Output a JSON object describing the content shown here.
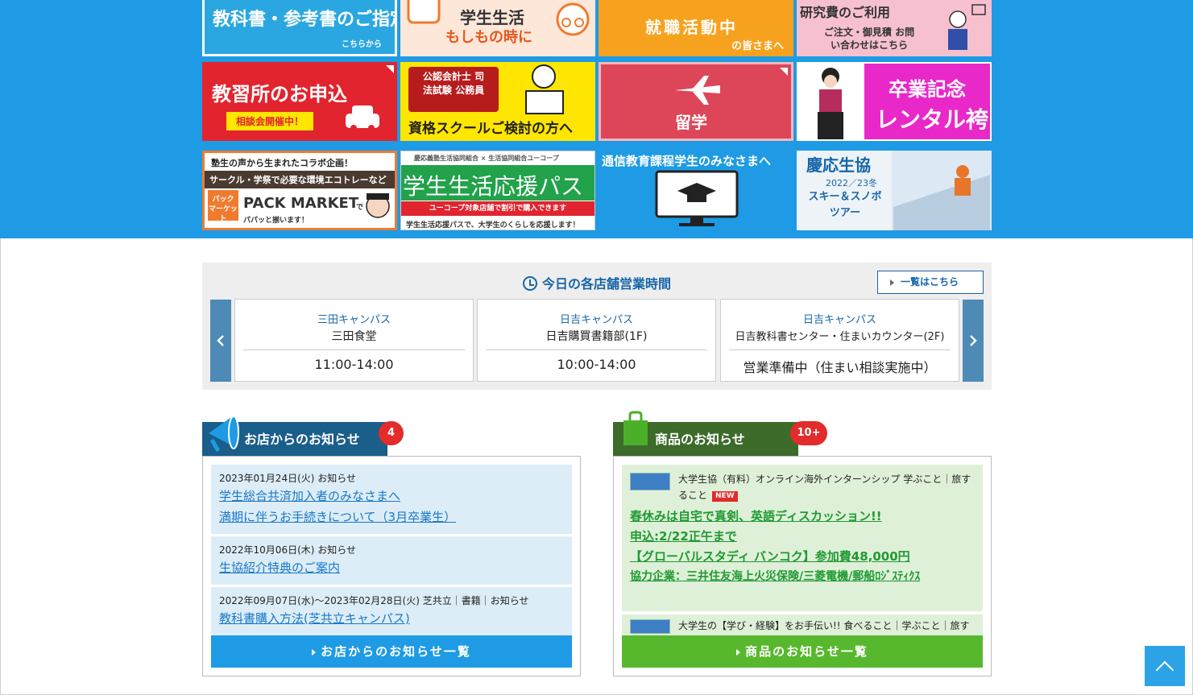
{
  "colors": {
    "banner_bg": "#1e9be4",
    "shop_news_header": "#1a5e8a",
    "product_news_header": "#3d6b2a",
    "accent_blue": "#1a78c8",
    "accent_green": "#1f9a33",
    "badge_red": "#e22b2b"
  },
  "banners": [
    {
      "text": "教科書・参考書のご指定",
      "sub": "こちらから"
    },
    {
      "text": "学生生活",
      "sub": "もしもの時に"
    },
    {
      "text": "就職活動中",
      "sub": "の皆さまへ"
    },
    {
      "text": "研究費のご利用",
      "sub": "ご注文・御見積 お問い合わせはこちら"
    },
    {
      "text": "教習所のお申込",
      "sub": "相談会開催中！"
    },
    {
      "text": "公認会計士 司法試験 公務員",
      "sub": "資格スクールご検討の方へ"
    },
    {
      "text": "留学",
      "sub": ""
    },
    {
      "text": "卒業記念",
      "sub": "レンタル袴"
    },
    {
      "text": "塾生の声から生まれたコラボ企画！",
      "sub": "サークル・学祭で必要な環境エコトレーなど",
      "sub2": "パック マーケット",
      "sub3": "PACK MARKET",
      "sub4": "で",
      "sub5": "パパッと揃います！"
    },
    {
      "text": "学生生活応援パス",
      "sub": "慶応義塾生活協同組合 × 生活協同組合ユーコープ",
      "sub2": "ユーコープ対象店舗で割引で購入できます",
      "sub3": "学生生活応援パスで、大学生のくらしを応援します！"
    },
    {
      "text": "通信教育課程学生のみなさまへ",
      "sub": ""
    },
    {
      "text": "慶応生協",
      "sub": "2022／23冬",
      "sub2": "スキー＆スノボ ツアー"
    }
  ],
  "hours": {
    "title": "今日の各店舗営業時間",
    "list_button": "一覧はこちら",
    "prev_icon": "chevron-left-icon",
    "next_icon": "chevron-right-icon",
    "cards": [
      {
        "campus": "三田キャンパス",
        "store": "三田食堂",
        "time": "11:00-14:00"
      },
      {
        "campus": "日吉キャンパス",
        "store": "日吉購買書籍部(1F)",
        "time": "10:00-14:00"
      },
      {
        "campus": "日吉キャンパス",
        "store": "日吉教科書センター・住まいカウンター(2F)",
        "time": "営業準備中（住まい相談実施中）"
      }
    ]
  },
  "shop_news": {
    "title": "お店からのお知らせ",
    "badge": "4",
    "items": [
      {
        "meta": "2023年01月24日(火) お知らせ",
        "lines": [
          "学生総合共済加入者のみなさまへ",
          "満期に伴うお手続きについて（3月卒業生）"
        ]
      },
      {
        "meta": "2022年10月06日(木) お知らせ",
        "lines": [
          "生協紹介特典のご案内"
        ]
      },
      {
        "meta": "2022年09月07日(水)～2023年02月28日(火) 芝共立｜書籍｜お知らせ",
        "lines": [
          "教科書購入方法(芝共立キャンパス)"
        ]
      }
    ],
    "all_button": "お店からのお知らせ一覧"
  },
  "product_news": {
    "title": "商品のお知らせ",
    "badge": "10+",
    "items": [
      {
        "meta": "大学生協（有料）オンライン海外インターンシップ 学ぶこと｜旅すること",
        "new_tag": "NEW",
        "lines": [
          "春休みは自宅で真剣、英語ディスカッション!!",
          "申込:2/22正午まで",
          "【グローバルスタディ バンコク】参加費48,000円",
          "協力企業：三井住友海上火災保険/三菱電機/郵船ﾛｼﾞｽﾃｨｸｽ"
        ]
      },
      {
        "meta": "大学生の【学び・経験】をお手伝い!! 食べること｜学ぶこと｜旅す",
        "new_tag": "",
        "lines": []
      }
    ],
    "all_button": "商品のお知らせ一覧"
  },
  "page_top_icon": "arrow-up-icon"
}
